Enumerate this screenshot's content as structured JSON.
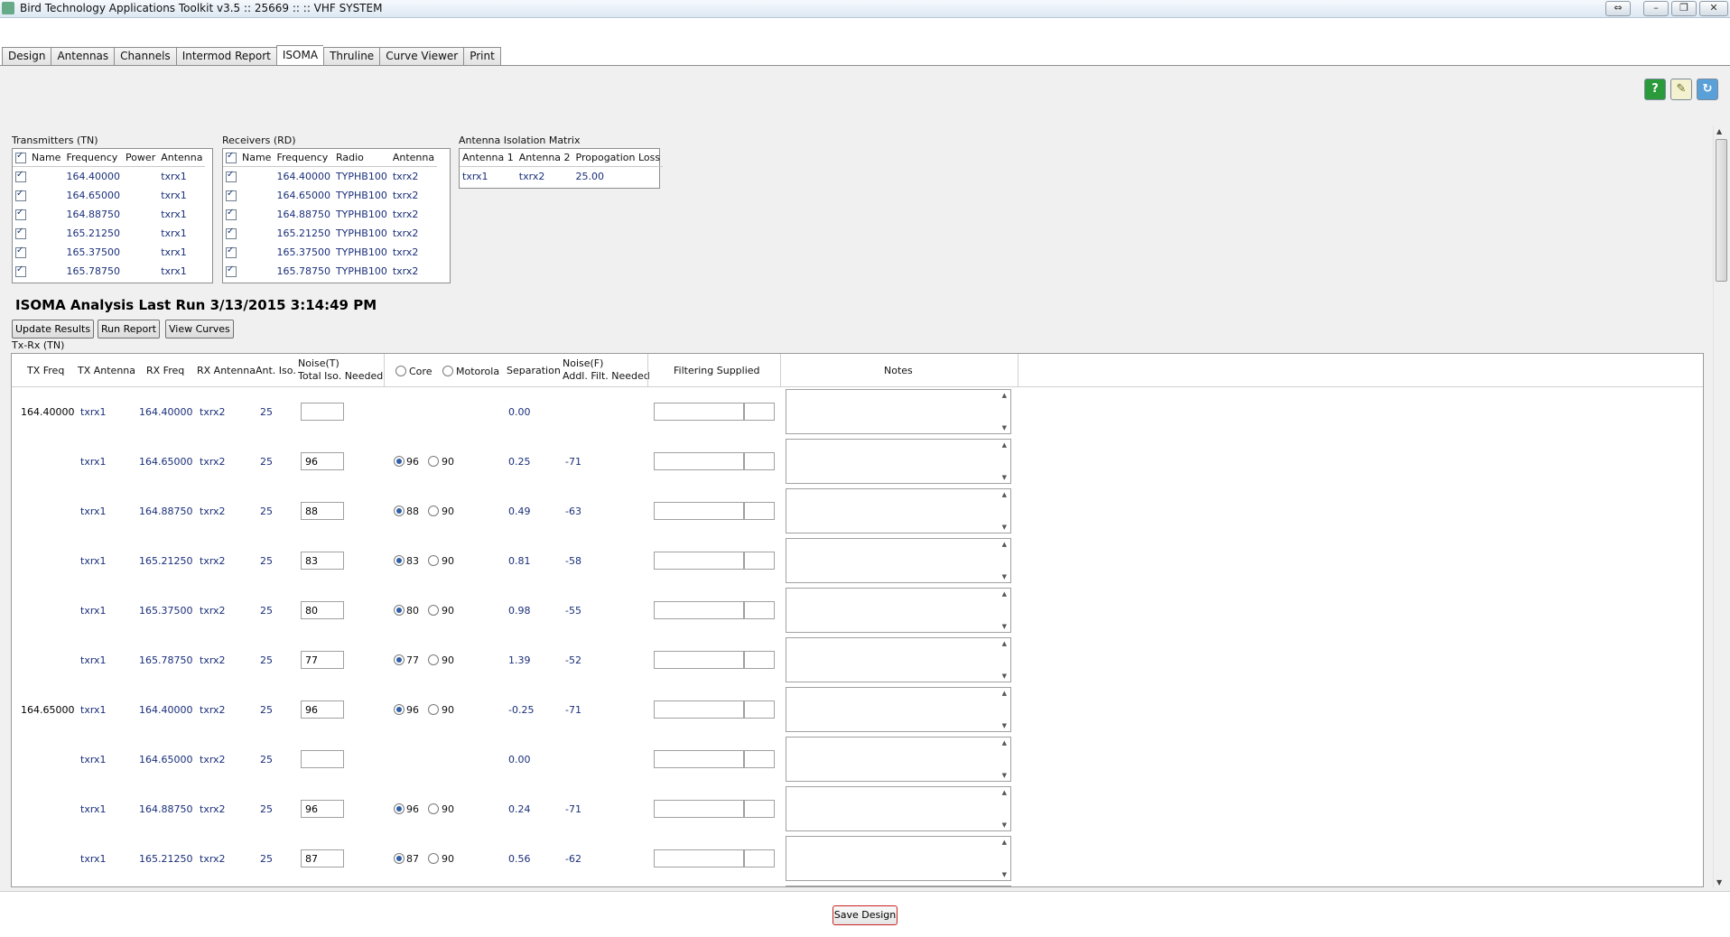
{
  "window": {
    "title": "Bird Technology Applications Toolkit v3.5  :: 25669 ::  :: VHF SYSTEM"
  },
  "tabs": [
    {
      "label": "Design"
    },
    {
      "label": "Antennas"
    },
    {
      "label": "Channels"
    },
    {
      "label": "Intermod Report"
    },
    {
      "label": "ISOMA",
      "active": true
    },
    {
      "label": "Thruline"
    },
    {
      "label": "Curve Viewer"
    },
    {
      "label": "Print"
    }
  ],
  "toolbar_icons": [
    "help-icon",
    "notes-icon",
    "refresh-icon"
  ],
  "transmitters": {
    "label": "Transmitters (TN)",
    "headers": [
      "Name",
      "Frequency",
      "Power",
      "Antenna"
    ],
    "rows": [
      {
        "checked": true,
        "name": "",
        "frequency": "164.40000",
        "power": "",
        "antenna": "txrx1"
      },
      {
        "checked": true,
        "name": "",
        "frequency": "164.65000",
        "power": "",
        "antenna": "txrx1"
      },
      {
        "checked": true,
        "name": "",
        "frequency": "164.88750",
        "power": "",
        "antenna": "txrx1"
      },
      {
        "checked": true,
        "name": "",
        "frequency": "165.21250",
        "power": "",
        "antenna": "txrx1"
      },
      {
        "checked": true,
        "name": "",
        "frequency": "165.37500",
        "power": "",
        "antenna": "txrx1"
      },
      {
        "checked": true,
        "name": "",
        "frequency": "165.78750",
        "power": "",
        "antenna": "txrx1"
      }
    ]
  },
  "receivers": {
    "label": "Receivers (RD)",
    "headers": [
      "Name",
      "Frequency",
      "Radio",
      "Antenna"
    ],
    "rows": [
      {
        "checked": true,
        "name": "",
        "frequency": "164.40000",
        "radio": "TYPHB100",
        "antenna": "txrx2"
      },
      {
        "checked": true,
        "name": "",
        "frequency": "164.65000",
        "radio": "TYPHB100",
        "antenna": "txrx2"
      },
      {
        "checked": true,
        "name": "",
        "frequency": "164.88750",
        "radio": "TYPHB100",
        "antenna": "txrx2"
      },
      {
        "checked": true,
        "name": "",
        "frequency": "165.21250",
        "radio": "TYPHB100",
        "antenna": "txrx2"
      },
      {
        "checked": true,
        "name": "",
        "frequency": "165.37500",
        "radio": "TYPHB100",
        "antenna": "txrx2"
      },
      {
        "checked": true,
        "name": "",
        "frequency": "165.78750",
        "radio": "TYPHB100",
        "antenna": "txrx2"
      }
    ]
  },
  "isolation_matrix": {
    "label": "Antenna Isolation Matrix",
    "headers": [
      "Antenna 1",
      "Antenna 2",
      "Propogation Loss"
    ],
    "rows": [
      {
        "antenna1": "txrx1",
        "antenna2": "txrx2",
        "loss": "25.00"
      }
    ]
  },
  "analysis": {
    "heading": "ISOMA Analysis Last Run 3/13/2015 3:14:49 PM",
    "buttons": {
      "update": "Update Results",
      "run_report": "Run Report",
      "view_curves": "View Curves"
    },
    "section_label": "Tx-Rx (TN)",
    "headers": {
      "tx_freq": "TX Freq",
      "tx_antenna": "TX Antenna",
      "rx_freq": "RX Freq",
      "rx_antenna": "RX Antenna",
      "ant_iso": "Ant. Iso.",
      "noise_t_1": "Noise(T)",
      "noise_t_2": "Total Iso. Needed",
      "core": "Core",
      "motorola": "Motorola",
      "separation": "Separation",
      "noise_f_1": "Noise(F)",
      "noise_f_2": "Addl. Filt. Needed",
      "filtering": "Filtering Supplied",
      "notes": "Notes"
    },
    "rows": [
      {
        "tx_freq": "164.40000",
        "tx_antenna": "txrx1",
        "rx_freq": "164.40000",
        "rx_antenna": "txrx2",
        "ant_iso": "25",
        "total_iso": "",
        "radio_options": [],
        "separation": "0.00",
        "addl_filt": ""
      },
      {
        "tx_freq": "",
        "tx_antenna": "txrx1",
        "rx_freq": "164.65000",
        "rx_antenna": "txrx2",
        "ant_iso": "25",
        "total_iso": "96",
        "radio_options": [
          "96",
          "90"
        ],
        "separation": "0.25",
        "addl_filt": "-71"
      },
      {
        "tx_freq": "",
        "tx_antenna": "txrx1",
        "rx_freq": "164.88750",
        "rx_antenna": "txrx2",
        "ant_iso": "25",
        "total_iso": "88",
        "radio_options": [
          "88",
          "90"
        ],
        "separation": "0.49",
        "addl_filt": "-63"
      },
      {
        "tx_freq": "",
        "tx_antenna": "txrx1",
        "rx_freq": "165.21250",
        "rx_antenna": "txrx2",
        "ant_iso": "25",
        "total_iso": "83",
        "radio_options": [
          "83",
          "90"
        ],
        "separation": "0.81",
        "addl_filt": "-58"
      },
      {
        "tx_freq": "",
        "tx_antenna": "txrx1",
        "rx_freq": "165.37500",
        "rx_antenna": "txrx2",
        "ant_iso": "25",
        "total_iso": "80",
        "radio_options": [
          "80",
          "90"
        ],
        "separation": "0.98",
        "addl_filt": "-55"
      },
      {
        "tx_freq": "",
        "tx_antenna": "txrx1",
        "rx_freq": "165.78750",
        "rx_antenna": "txrx2",
        "ant_iso": "25",
        "total_iso": "77",
        "radio_options": [
          "77",
          "90"
        ],
        "separation": "1.39",
        "addl_filt": "-52"
      },
      {
        "tx_freq": "164.65000",
        "tx_antenna": "txrx1",
        "rx_freq": "164.40000",
        "rx_antenna": "txrx2",
        "ant_iso": "25",
        "total_iso": "96",
        "radio_options": [
          "96",
          "90"
        ],
        "separation": "-0.25",
        "addl_filt": "-71"
      },
      {
        "tx_freq": "",
        "tx_antenna": "txrx1",
        "rx_freq": "164.65000",
        "rx_antenna": "txrx2",
        "ant_iso": "25",
        "total_iso": "",
        "radio_options": [],
        "separation": "0.00",
        "addl_filt": ""
      },
      {
        "tx_freq": "",
        "tx_antenna": "txrx1",
        "rx_freq": "164.88750",
        "rx_antenna": "txrx2",
        "ant_iso": "25",
        "total_iso": "96",
        "radio_options": [
          "96",
          "90"
        ],
        "separation": "0.24",
        "addl_filt": "-71"
      },
      {
        "tx_freq": "",
        "tx_antenna": "txrx1",
        "rx_freq": "165.21250",
        "rx_antenna": "txrx2",
        "ant_iso": "25",
        "total_iso": "87",
        "radio_options": [
          "87",
          "90"
        ],
        "separation": "0.56",
        "addl_filt": "-62"
      }
    ]
  },
  "footer": {
    "save_label": "Save Design"
  }
}
